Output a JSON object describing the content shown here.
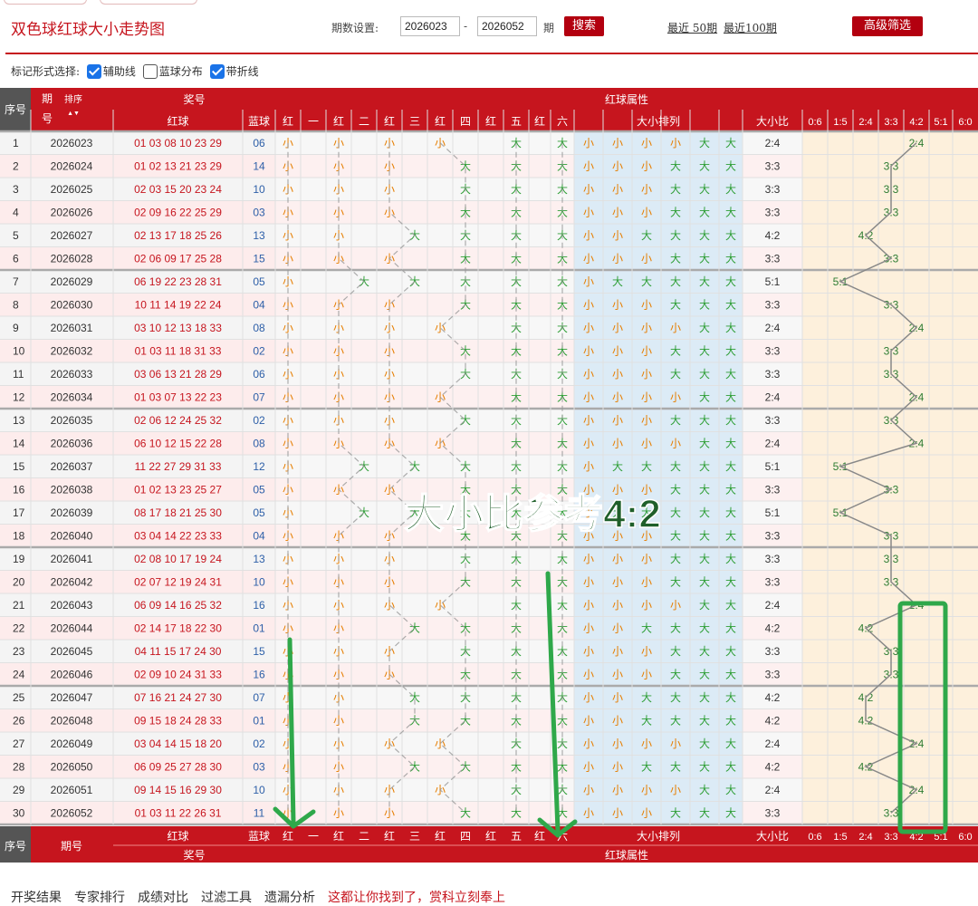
{
  "header": {
    "title": "双色球红球大小走势图",
    "period_label": "期数设置:",
    "from": "2026023",
    "to": "2026052",
    "dash": "-",
    "period_unit": "期",
    "search": "搜索",
    "recent50": "最近 50期",
    "recent100": "最近100期",
    "advanced": "高级筛选"
  },
  "markbar": {
    "label": "标记形式选择:",
    "opt1": "辅助线",
    "opt2": "蓝球分布",
    "opt3": "带折线"
  },
  "table": {
    "h_seq": "序号",
    "h_period": "期号",
    "h_sort": "排序",
    "h_prize": "奖号",
    "h_red": "红球",
    "h_blue": "蓝球",
    "h_attr": "红球属性",
    "pos_headers": [
      [
        "红",
        "一"
      ],
      [
        "红",
        "二"
      ],
      [
        "红",
        "三"
      ],
      [
        "红",
        "四"
      ],
      [
        "红",
        "五"
      ],
      [
        "红",
        "六"
      ]
    ],
    "h_arrange": "大小排列",
    "h_ratio_col": "大小比",
    "ratios": [
      "0:6",
      "1:5",
      "2:4",
      "3:3",
      "4:2",
      "5:1",
      "6:0"
    ],
    "rows": [
      [
        "1",
        "2026023",
        "01 03 08 10 23 29",
        "06"
      ],
      [
        "2",
        "2026024",
        "01 02 13 21 23 29",
        "14"
      ],
      [
        "3",
        "2026025",
        "02 03 15 20 23 24",
        "10"
      ],
      [
        "4",
        "2026026",
        "02 09 16 22 25 29",
        "03"
      ],
      [
        "5",
        "2026027",
        "02 13 17 18 25 26",
        "13"
      ],
      [
        "6",
        "2026028",
        "02 06 09 17 25 28",
        "15"
      ],
      [
        "7",
        "2026029",
        "06 19 22 23 28 31",
        "05"
      ],
      [
        "8",
        "2026030",
        "10 11 14 19 22 24",
        "04"
      ],
      [
        "9",
        "2026031",
        "03 10 12 13 18 33",
        "08"
      ],
      [
        "10",
        "2026032",
        "01 03 11 18 31 33",
        "02"
      ],
      [
        "11",
        "2026033",
        "03 06 13 21 28 29",
        "06"
      ],
      [
        "12",
        "2026034",
        "01 03 07 13 22 23",
        "07"
      ],
      [
        "13",
        "2026035",
        "02 06 12 24 25 32",
        "02"
      ],
      [
        "14",
        "2026036",
        "06 10 12 15 22 28",
        "08"
      ],
      [
        "15",
        "2026037",
        "11 22 27 29 31 33",
        "12"
      ],
      [
        "16",
        "2026038",
        "01 02 13 23 25 27",
        "05"
      ],
      [
        "17",
        "2026039",
        "08 17 18 21 25 30",
        "05"
      ],
      [
        "18",
        "2026040",
        "03 04 14 22 23 33",
        "04"
      ],
      [
        "19",
        "2026041",
        "02 08 10 17 19 24",
        "13"
      ],
      [
        "20",
        "2026042",
        "02 07 12 19 24 31",
        "10"
      ],
      [
        "21",
        "2026043",
        "06 09 14 16 25 32",
        "16"
      ],
      [
        "22",
        "2026044",
        "02 14 17 18 22 30",
        "01"
      ],
      [
        "23",
        "2026045",
        "04 11 15 17 24 30",
        "15"
      ],
      [
        "24",
        "2026046",
        "02 09 10 24 31 33",
        "16"
      ],
      [
        "25",
        "2026047",
        "07 16 21 24 27 30",
        "07"
      ],
      [
        "26",
        "2026048",
        "09 15 18 24 28 33",
        "01"
      ],
      [
        "27",
        "2026049",
        "03 04 14 15 18 20",
        "02"
      ],
      [
        "28",
        "2026050",
        "06 09 25 27 28 30",
        "03"
      ],
      [
        "29",
        "2026051",
        "09 14 15 16 29 30",
        "10"
      ],
      [
        "30",
        "2026052",
        "01 03 11 22 26 31",
        "11"
      ]
    ],
    "small": "小",
    "big": "大",
    "footer_seq": "序号",
    "footer_period": "期号",
    "footer_prize": "奖号"
  },
  "overlay": {
    "text": "大小比参考4:2"
  },
  "bottom_nav": [
    "开奖结果",
    "专家排行",
    "成绩对比",
    "过滤工具",
    "遗漏分析"
  ],
  "bottom_highlight": "这都让你找到了，赏科立刻奉上",
  "colors": {
    "header_red": "#c6151e",
    "green_text": "#2e9e36",
    "orange_text": "#e67e00",
    "blue_ball": "#2d5fa8",
    "red_ball": "#c6151e",
    "annotation_green": "#2fa84a"
  }
}
